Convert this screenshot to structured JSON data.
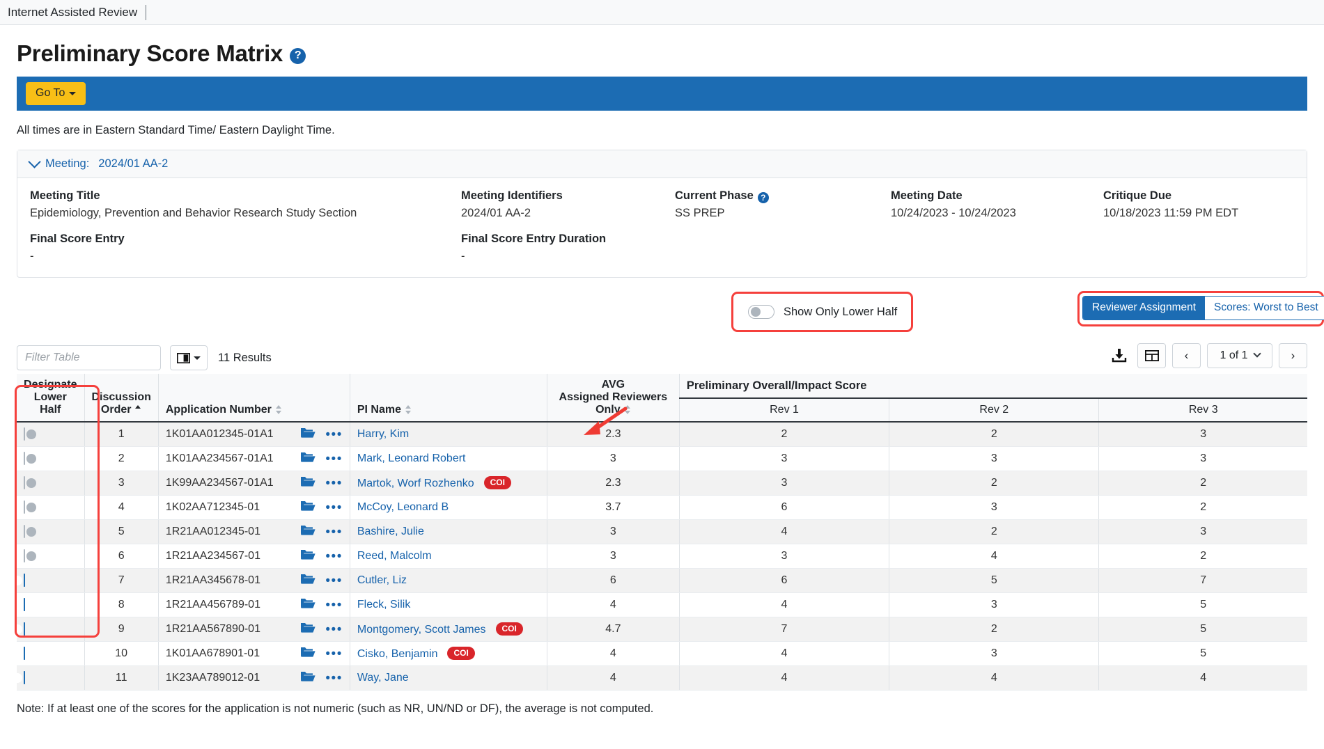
{
  "topbar": {
    "app_name": "Internet Assisted Review"
  },
  "header": {
    "title": "Preliminary Score Matrix",
    "help_icon": "question-circle-icon",
    "goto_label": "Go To",
    "times_note": "All times are in Eastern Standard Time/ Eastern Daylight Time."
  },
  "meeting_card": {
    "collapse_label": "Meeting:",
    "collapse_value": "2024/01 AA-2",
    "fields": [
      {
        "label": "Meeting Title",
        "value": "Epidemiology, Prevention and Behavior Research Study Section",
        "help": false
      },
      {
        "label": "Meeting Identifiers",
        "value": "2024/01 AA-2",
        "help": false
      },
      {
        "label": "Current Phase",
        "value": "SS PREP",
        "help": true
      },
      {
        "label": "Meeting Date",
        "value": "10/24/2023 - 10/24/2023",
        "help": false
      },
      {
        "label": "Critique Due",
        "value": "10/18/2023 11:59 PM EDT",
        "help": false
      },
      {
        "label": "Final Score Entry",
        "value": "-",
        "help": false
      },
      {
        "label": "Final Score Entry Duration",
        "value": "-",
        "help": false
      }
    ]
  },
  "controls": {
    "show_lower_half_label": "Show Only Lower Half",
    "show_lower_half_on": false,
    "view_toggle": {
      "options": [
        "Reviewer Assignment",
        "Scores: Worst to Best"
      ],
      "selected": "Reviewer Assignment"
    }
  },
  "toolbar": {
    "filter_placeholder": "Filter Table",
    "filter_value": "",
    "columns_button_icon": "columns-icon",
    "results_count": "11 Results",
    "download_icon": "download-icon",
    "grid_icon": "grid-icon",
    "prev_label": "‹",
    "next_label": "›",
    "page_label": "1 of 1"
  },
  "table": {
    "group_header": "Preliminary Overall/Impact Score",
    "columns": [
      {
        "label_line1": "Designate",
        "label_line2": "Lower Half",
        "sortable": false
      },
      {
        "label_line1": "Discussion",
        "label_line2": "Order",
        "sortable": true,
        "sorted": "asc"
      },
      {
        "label_line1": "",
        "label_line2": "Application Number",
        "sortable": true,
        "sorted": "none"
      },
      {
        "label_line1": "",
        "label_line2": "PI Name",
        "sortable": true,
        "sorted": "none"
      },
      {
        "label_line1": "AVG",
        "label_line2": "Assigned Reviewers",
        "label_line3": "Only",
        "sortable": true,
        "sorted": "none"
      }
    ],
    "rev_columns": [
      "Rev 1",
      "Rev 2",
      "Rev 3"
    ],
    "rows": [
      {
        "designate": false,
        "order": "1",
        "application_number": "1K01AA012345-01A1",
        "pi_name": "Harry, Kim",
        "coi": false,
        "avg": "2.3",
        "rev1": "2",
        "rev2": "2",
        "rev3": "3"
      },
      {
        "designate": false,
        "order": "2",
        "application_number": "1K01AA234567-01A1",
        "pi_name": "Mark, Leonard Robert",
        "coi": false,
        "avg": "3",
        "rev1": "3",
        "rev2": "3",
        "rev3": "3"
      },
      {
        "designate": false,
        "order": "3",
        "application_number": "1K99AA234567-01A1",
        "pi_name": "Martok, Worf Rozhenko",
        "coi": true,
        "avg": "2.3",
        "rev1": "3",
        "rev2": "2",
        "rev3": "2"
      },
      {
        "designate": false,
        "order": "4",
        "application_number": "1K02AA712345-01",
        "pi_name": "McCoy, Leonard B",
        "coi": false,
        "avg": "3.7",
        "rev1": "6",
        "rev2": "3",
        "rev3": "2"
      },
      {
        "designate": false,
        "order": "5",
        "application_number": "1R21AA012345-01",
        "pi_name": "Bashire, Julie",
        "coi": false,
        "avg": "3",
        "rev1": "4",
        "rev2": "2",
        "rev3": "3"
      },
      {
        "designate": false,
        "order": "6",
        "application_number": "1R21AA234567-01",
        "pi_name": "Reed, Malcolm",
        "coi": false,
        "avg": "3",
        "rev1": "3",
        "rev2": "4",
        "rev3": "2"
      },
      {
        "designate": true,
        "order": "7",
        "application_number": "1R21AA345678-01",
        "pi_name": "Cutler, Liz",
        "coi": false,
        "avg": "6",
        "rev1": "6",
        "rev2": "5",
        "rev3": "7"
      },
      {
        "designate": true,
        "order": "8",
        "application_number": "1R21AA456789-01",
        "pi_name": "Fleck, Silik",
        "coi": false,
        "avg": "4",
        "rev1": "4",
        "rev2": "3",
        "rev3": "5"
      },
      {
        "designate": true,
        "order": "9",
        "application_number": "1R21AA567890-01",
        "pi_name": "Montgomery, Scott James",
        "coi": true,
        "avg": "4.7",
        "rev1": "7",
        "rev2": "2",
        "rev3": "5"
      },
      {
        "designate": true,
        "order": "10",
        "application_number": "1K01AA678901-01",
        "pi_name": "Cisko, Benjamin",
        "coi": true,
        "avg": "4",
        "rev1": "4",
        "rev2": "3",
        "rev3": "5"
      },
      {
        "designate": true,
        "order": "11",
        "application_number": "1K23AA789012-01",
        "pi_name": "Way, Jane",
        "coi": false,
        "avg": "4",
        "rev1": "4",
        "rev2": "4",
        "rev3": "4"
      }
    ],
    "coi_badge": "COI"
  },
  "footer": {
    "note": "Note: If at least one of the scores for the application is not numeric (such as NR, UN/ND or DF), the average is not computed."
  },
  "colors": {
    "accent_blue": "#1c6cb3",
    "link_blue": "#1662ab",
    "goto_yellow": "#f8bf16",
    "coi_red": "#d9252a",
    "annotation_red": "#f5403c"
  }
}
